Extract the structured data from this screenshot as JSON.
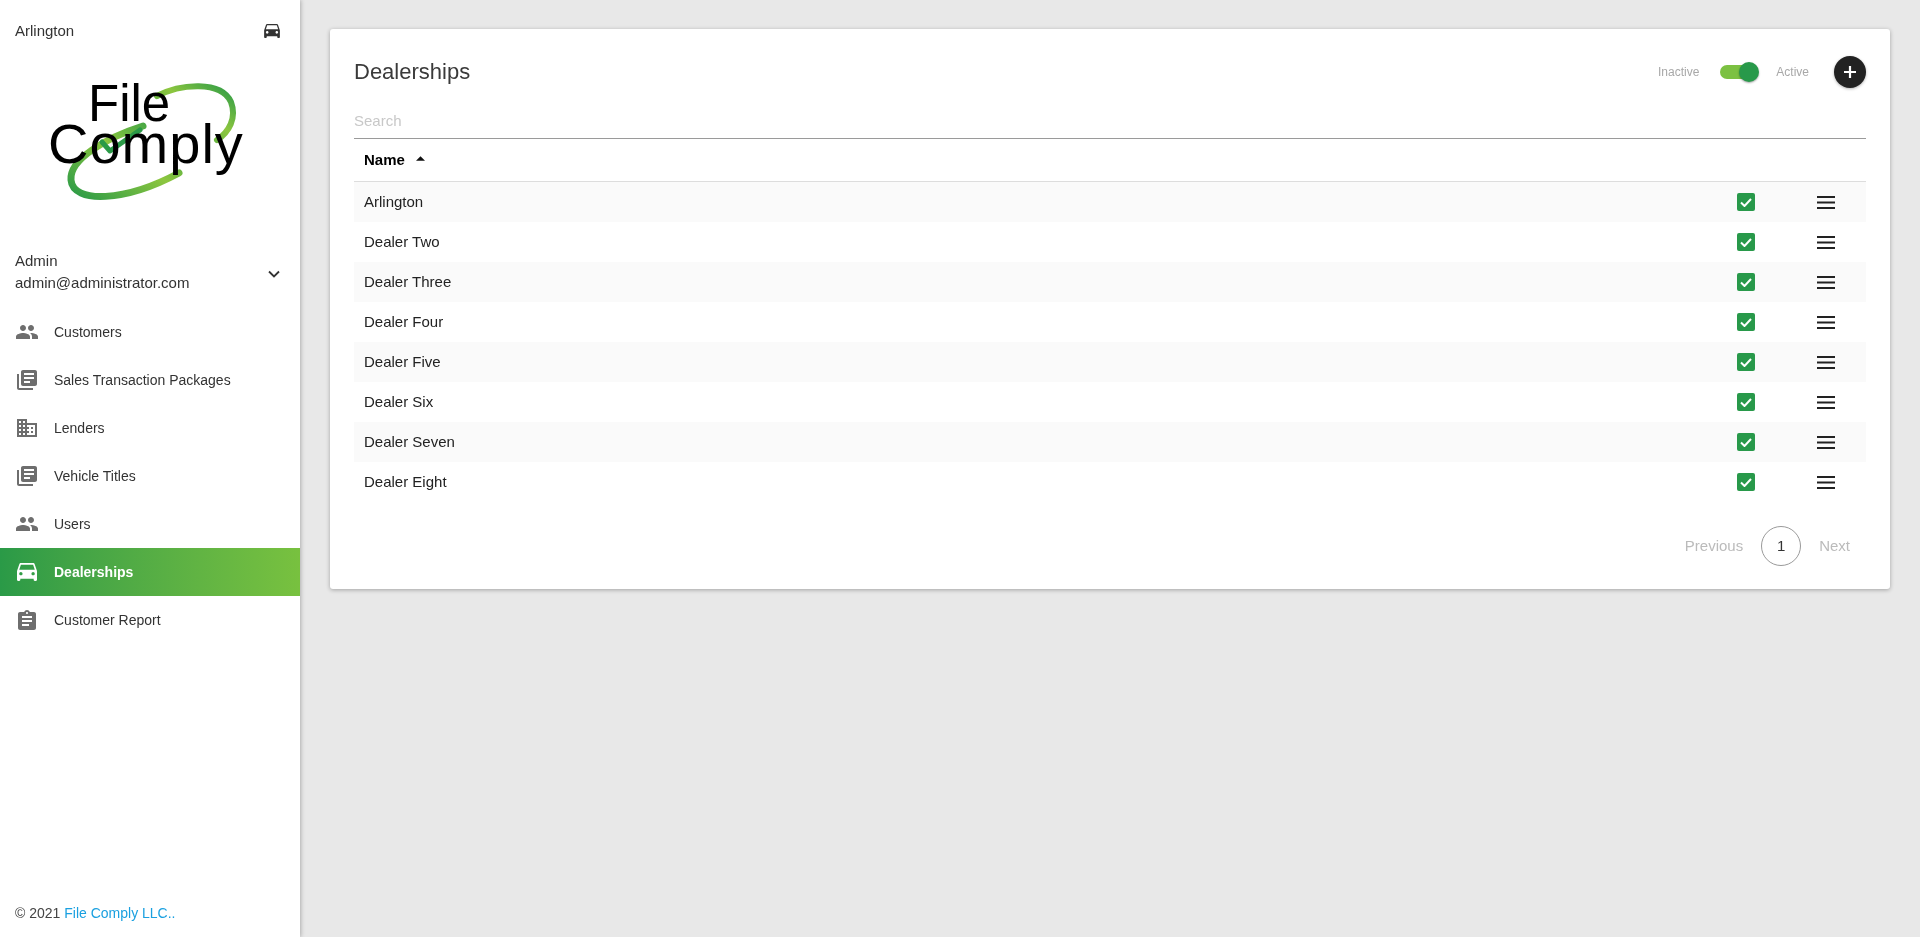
{
  "sidebar": {
    "dealership": "Arlington",
    "logo_text": [
      "File",
      "Comply"
    ],
    "user": {
      "name": "Admin",
      "email": "admin@administrator.com",
      "expanded": false
    },
    "nav": [
      {
        "label": "Customers",
        "kind": "people",
        "selected": false
      },
      {
        "label": "Sales Transaction Packages",
        "kind": "documents",
        "selected": false
      },
      {
        "label": "Lenders",
        "kind": "building",
        "selected": false
      },
      {
        "label": "Vehicle Titles",
        "kind": "documents",
        "selected": false
      },
      {
        "label": "Users",
        "kind": "people",
        "selected": false
      },
      {
        "label": "Dealerships",
        "kind": "car",
        "selected": true
      },
      {
        "label": "Customer Report",
        "kind": "clipboard",
        "selected": false
      }
    ],
    "footer": {
      "copyright": "© 2021 ",
      "link": "File Comply LLC.."
    }
  },
  "card": {
    "title": "Dealerships",
    "status_toggle": {
      "off_label": "Inactive",
      "on_label": "Active",
      "on": true
    },
    "search": {
      "placeholder": "Search"
    },
    "table": {
      "columns": [
        {
          "label": "Name",
          "sort_ascending": true
        }
      ],
      "rows": [
        {
          "name": "Arlington",
          "checked": true
        },
        {
          "name": "Dealer Two",
          "checked": true
        },
        {
          "name": "Dealer Three",
          "checked": true
        },
        {
          "name": "Dealer Four",
          "checked": true
        },
        {
          "name": "Dealer Five",
          "checked": true
        },
        {
          "name": "Dealer Six",
          "checked": true
        },
        {
          "name": "Dealer Seven",
          "checked": true
        },
        {
          "name": "Dealer Eight",
          "checked": true
        }
      ]
    },
    "pagination": {
      "previous": "Previous",
      "pages": [
        {
          "label": "1",
          "selected": true
        }
      ],
      "next": "Next"
    }
  }
}
